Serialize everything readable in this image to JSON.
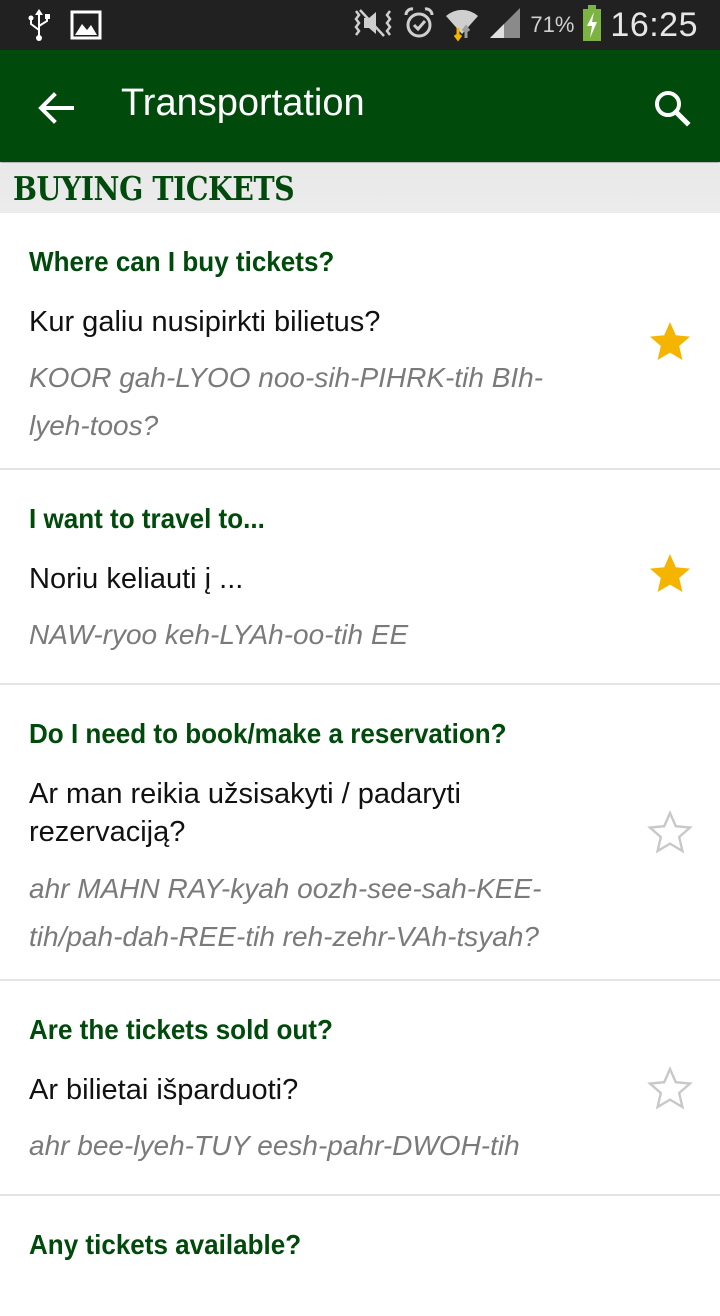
{
  "status_bar": {
    "left_icons": [
      "usb-icon",
      "image-icon"
    ],
    "right_icons": [
      "mute-vibrate-icon",
      "alarm-icon",
      "wifi-icon",
      "signal-icon",
      "battery-charging-icon"
    ],
    "battery_percent": "71%",
    "time": "16:25",
    "battery_color": "#7cb342"
  },
  "app_bar": {
    "title": "Transportation",
    "back_icon": "arrow-left-icon",
    "search_icon": "search-icon",
    "background": "#004a0b"
  },
  "section": {
    "title": "BUYING TICKETS"
  },
  "phrases": [
    {
      "english": "Where can I buy tickets?",
      "lithuanian": "Kur galiu nusipirkti bilietus?",
      "pronunciation": "KOOR gah-LYOO noo-sih-PIHRK-tih BIh-lyeh-toos?",
      "favorite": true
    },
    {
      "english": "I want to travel to...",
      "lithuanian": "Noriu keliauti į ...",
      "pronunciation": "NAW-ryoo keh-LYAh-oo-tih EE",
      "favorite": true
    },
    {
      "english": "Do I need to book/make a reservation?",
      "lithuanian": "Ar man reikia užsisakyti / padaryti rezervaciją?",
      "pronunciation": "ahr MAHN RAY-kyah oozh-see-sah-KEE-tih/pah-dah-REE-tih reh-zehr-VAh-tsyah?",
      "favorite": false
    },
    {
      "english": "Are the tickets sold out?",
      "lithuanian": "Ar bilietai išparduoti?",
      "pronunciation": "ahr bee-lyeh-TUY eesh-pahr-DWOH-tih",
      "favorite": false
    },
    {
      "english": "Any tickets available?",
      "lithuanian": "",
      "pronunciation": "",
      "favorite": false
    }
  ],
  "colors": {
    "accent_green": "#004a0b",
    "star_filled": "#f4b400",
    "star_empty": "#c8c8c8",
    "pronunciation_gray": "#7a7a7a"
  }
}
